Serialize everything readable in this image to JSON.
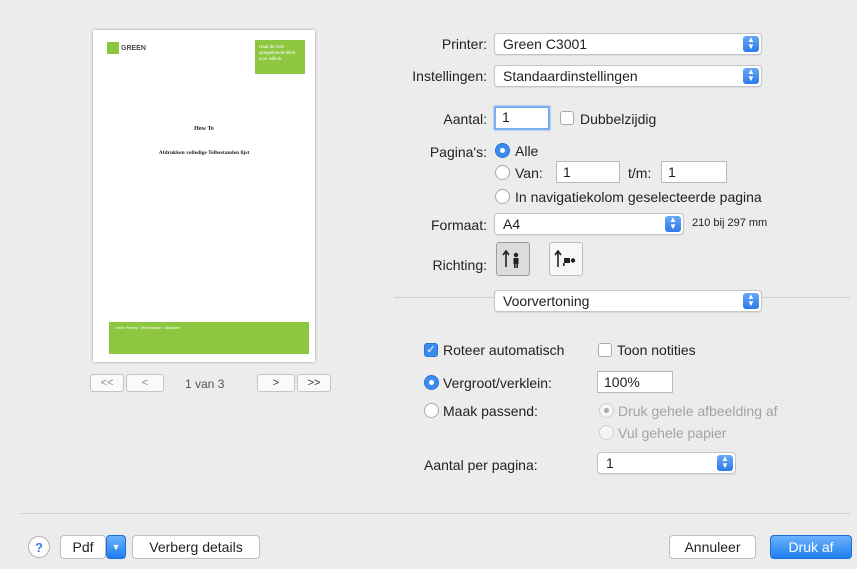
{
  "preview": {
    "logo_text": "GREEN",
    "badge_text": "Haal de hele spiegelbeeld tekst voor afdruk",
    "doc_title": "How To",
    "doc_subtitle": "Afdrukken volledige Telbestanden lijst",
    "footer_text": "Green Printing · Telbestanden · Afdrukken",
    "pager": {
      "first": "<<",
      "prev": "<",
      "page_label": "1 van 3",
      "next": ">",
      "last": ">>"
    }
  },
  "printer": {
    "label": "Printer:",
    "value": "Green C3001"
  },
  "settings": {
    "label": "Instellingen:",
    "value": "Standaardinstellingen"
  },
  "copies": {
    "label": "Aantal:",
    "value": "1",
    "duplex_label": "Dubbelzijdig",
    "duplex_checked": false
  },
  "pages": {
    "label": "Pagina's:",
    "all_label": "Alle",
    "from_label": "Van:",
    "from_value": "1",
    "to_label": "t/m:",
    "to_value": "1",
    "selected_label": "In navigatiekolom geselecteerde pagina"
  },
  "paper": {
    "label": "Formaat:",
    "value": "A4",
    "size_text": "210 bij 297 mm"
  },
  "orientation": {
    "label": "Richting:"
  },
  "section": {
    "value": "Voorvertoning"
  },
  "preview_opts": {
    "rotate_label": "Roteer automatisch",
    "rotate_checked": true,
    "notes_label": "Toon notities",
    "notes_checked": false,
    "scale_label": "Vergroot/verklein:",
    "scale_value": "100%",
    "fit_label": "Maak passend:",
    "fit_whole_label": "Druk gehele afbeelding af",
    "fill_paper_label": "Vul gehele papier",
    "per_page_label": "Aantal per pagina:",
    "per_page_value": "1"
  },
  "footer": {
    "help": "?",
    "pdf_label": "Pdf",
    "hide_details": "Verberg details",
    "cancel": "Annuleer",
    "print": "Druk af"
  },
  "colors": {
    "accent": "#3c8cf0",
    "green": "#8dc63f"
  }
}
